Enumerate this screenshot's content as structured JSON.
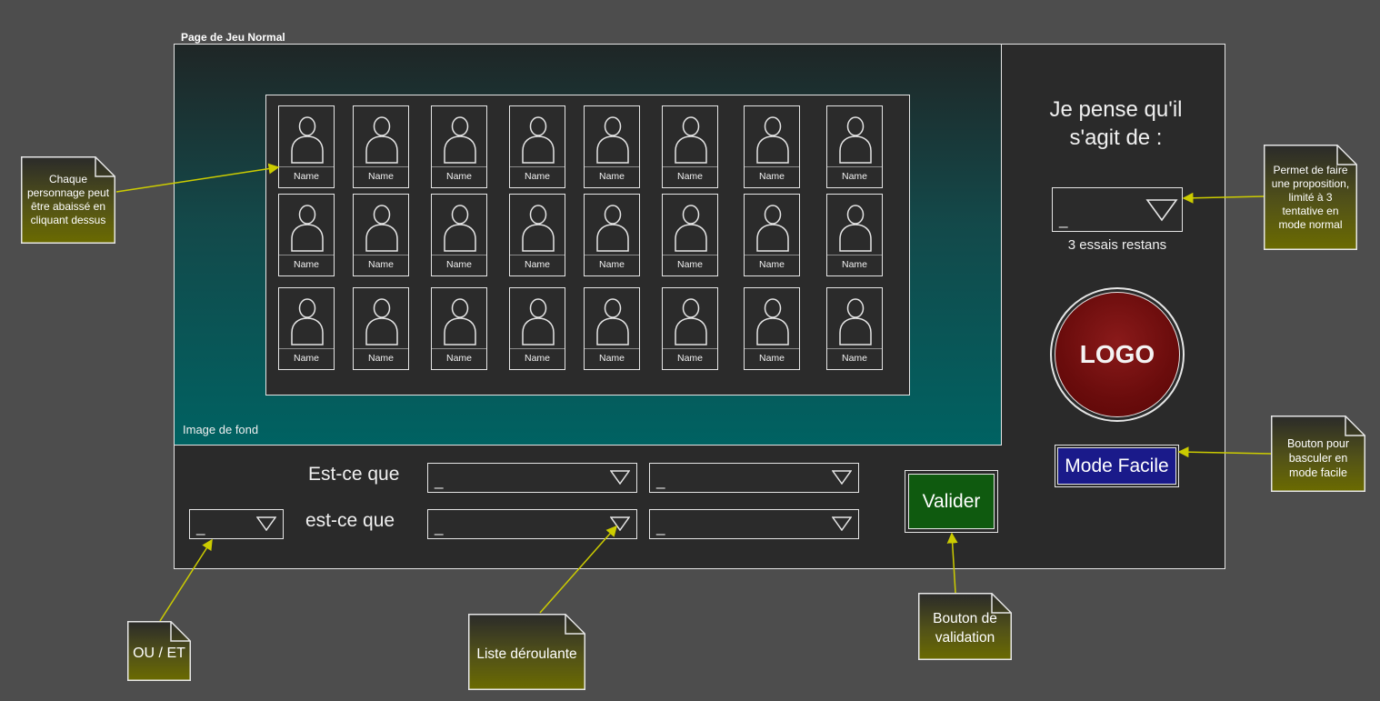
{
  "frame_title": "Page de Jeu Normal",
  "background_caption": "Image de fond",
  "characters": [
    "Name",
    "Name",
    "Name",
    "Name",
    "Name",
    "Name",
    "Name",
    "Name",
    "Name",
    "Name",
    "Name",
    "Name",
    "Name",
    "Name",
    "Name",
    "Name",
    "Name",
    "Name",
    "Name",
    "Name",
    "Name",
    "Name",
    "Name",
    "Name"
  ],
  "guess": {
    "prompt": "Je pense qu'il s'agit de :",
    "select_value": "_",
    "tries_text": "3 essais restans"
  },
  "logo_text": "LOGO",
  "easy_mode_label": "Mode Facile",
  "validate_label": "Valider",
  "question": {
    "row1_label": "Est-ce que",
    "row2_label": "est-ce que",
    "connector_value": "_",
    "selects": [
      "_",
      "_",
      "_",
      "_"
    ]
  },
  "notes": {
    "characters": "Chaque personnage peut être abaissé en cliquant dessus",
    "guess": "Permet de faire une proposition, limité à 3 tentative en mode normal",
    "easy": "Bouton pour basculer en mode facile",
    "connector": "OU / ET",
    "dropdown": "Liste déroulante",
    "validate": "Bouton de validation"
  },
  "colors": {
    "page_bg": "#4d4d4d",
    "panel_bg": "#2a2a2a",
    "bg_image_gradient_end": "#006262",
    "logo_red": "#6a0c0c",
    "easy_blue": "#1a1a8a",
    "validate_green": "#0f5a0f",
    "note_olive": "#6b6b00",
    "arrow_yellow": "#cccc00"
  }
}
